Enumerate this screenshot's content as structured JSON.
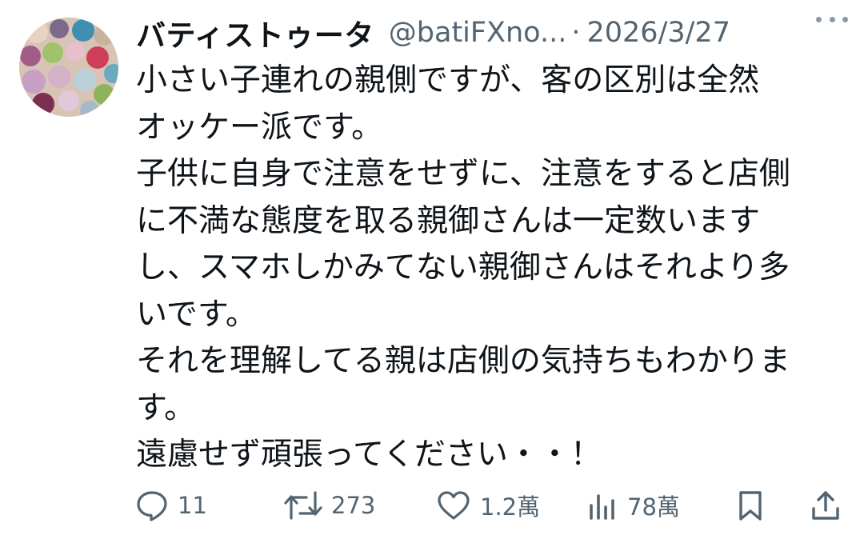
{
  "tweet": {
    "author_name": "バティストゥータ",
    "author_handle": "@batiFXno...",
    "separator": "·",
    "date": "2026/3/27",
    "text": "小さい子連れの親側ですが、客の区別は全然\nオッケー派です。\n子供に自身で注意をせずに、注意をすると店側\nに不満な態度を取る親御さんは一定数います\nし、スマホしかみてない親御さんはそれより多\nいです。\nそれを理解してる親は店側の気持ちもわかりま\nす。\n遠慮せず頑張ってください・・！"
  },
  "actions": {
    "reply": {
      "icon": "reply-icon",
      "count": "11"
    },
    "retweet": {
      "icon": "retweet-icon",
      "count": "273"
    },
    "like": {
      "icon": "heart-icon",
      "count": "1.2萬"
    },
    "views": {
      "icon": "views-chart-icon",
      "count": "78萬"
    },
    "bookmark": {
      "icon": "bookmark-icon"
    },
    "share": {
      "icon": "share-icon"
    }
  },
  "colors": {
    "text": "#0f1419",
    "secondary": "#536471",
    "background": "#ffffff"
  }
}
